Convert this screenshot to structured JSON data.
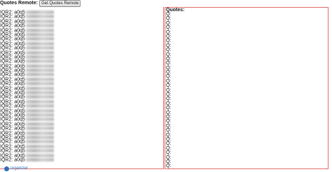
{
  "toolbar": {
    "label": "Quotes Remote:",
    "button_label": "Get Quotes Remote"
  },
  "left_panel": {
    "rows": [
      "IQR2: a0q5",
      "IQR2: a0q5",
      "IQR2: a0q5",
      "IQR2: a0q5",
      "IQR2: a0q5",
      "IQR2: a0q5",
      "IQR2: a0q5",
      "IQR2: a0q5",
      "IQR2: a0q5",
      "IQR2: a0q5",
      "IQR2: a0q5",
      "IQR2: a0q5",
      "IQR2: a0q5",
      "IQR2: a0q5",
      "IQR2: a0q5",
      "IQR2: a0q5",
      "IQR2: a0q5",
      "IQR2: a0q5",
      "IQR2: a0q5",
      "IQR2: a0q5",
      "IQR2: a0q5",
      "IQR2: a0q5",
      "IQR2: a0q5",
      "IQR2: a0q5",
      "IQR2: a0q5",
      "IQR2: a0q5",
      "IQR2: a0q5",
      "IQR2: a0q5",
      "IQR2: a0q5",
      "IQR2: a0q5",
      "IQR2: a0q5",
      "IQR2: a0q5",
      "IQR2: a0q5",
      "IQR2: a0q5"
    ]
  },
  "right_panel": {
    "title": "Quotes:",
    "rows": [
      "Q:",
      "Q:",
      "Q:",
      "Q:",
      "Q:",
      "Q:",
      "Q:",
      "Q:",
      "Q:",
      "Q:",
      "Q:",
      "Q:",
      "Q:",
      "Q:",
      "Q:",
      "Q:",
      "Q:",
      "Q:",
      "Q:",
      "Q:",
      "Q:",
      "Q:",
      "Q:",
      "Q:",
      "Q:",
      "Q:",
      "Q:",
      "Q:",
      "Q:",
      "Q:",
      "Q:",
      "Q:",
      "Q:",
      "Q:",
      "Q:"
    ]
  },
  "footer": {
    "logo_text": "organizer",
    "icon": "organizer-logo-icon",
    "accent_color": "#2e6fb7",
    "panel_border_color": "#e06a6a"
  }
}
